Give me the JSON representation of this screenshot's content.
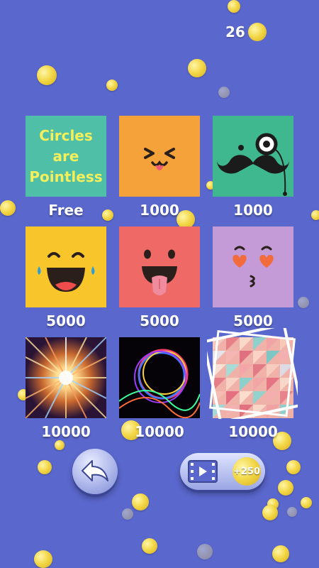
{
  "coins": {
    "count": "26"
  },
  "skins": [
    {
      "name": "circles-are-pointless",
      "text_lines": [
        "Circles",
        "are",
        "Pointless"
      ],
      "price": "Free",
      "bg": "#4fc0a7"
    },
    {
      "name": "squint-tongue-face",
      "price": "1000",
      "bg": "#f5a23a"
    },
    {
      "name": "mustache-monocle",
      "price": "1000",
      "bg": "#3fb88f"
    },
    {
      "name": "laughing-tears-face",
      "price": "5000",
      "bg": "#f8c52a"
    },
    {
      "name": "tongue-out-face",
      "price": "5000",
      "bg": "#ef6a67"
    },
    {
      "name": "heart-eyes-kiss-face",
      "price": "5000",
      "bg": "#c49bd6"
    },
    {
      "name": "light-burst",
      "price": "10000"
    },
    {
      "name": "neon-ring",
      "price": "10000"
    },
    {
      "name": "pastel-triangles",
      "price": "10000"
    }
  ],
  "video_reward": {
    "label": "+250"
  },
  "colors": {
    "background": "#5a67cc",
    "coin": "#f3d84a",
    "price_text": "#ffffff"
  }
}
